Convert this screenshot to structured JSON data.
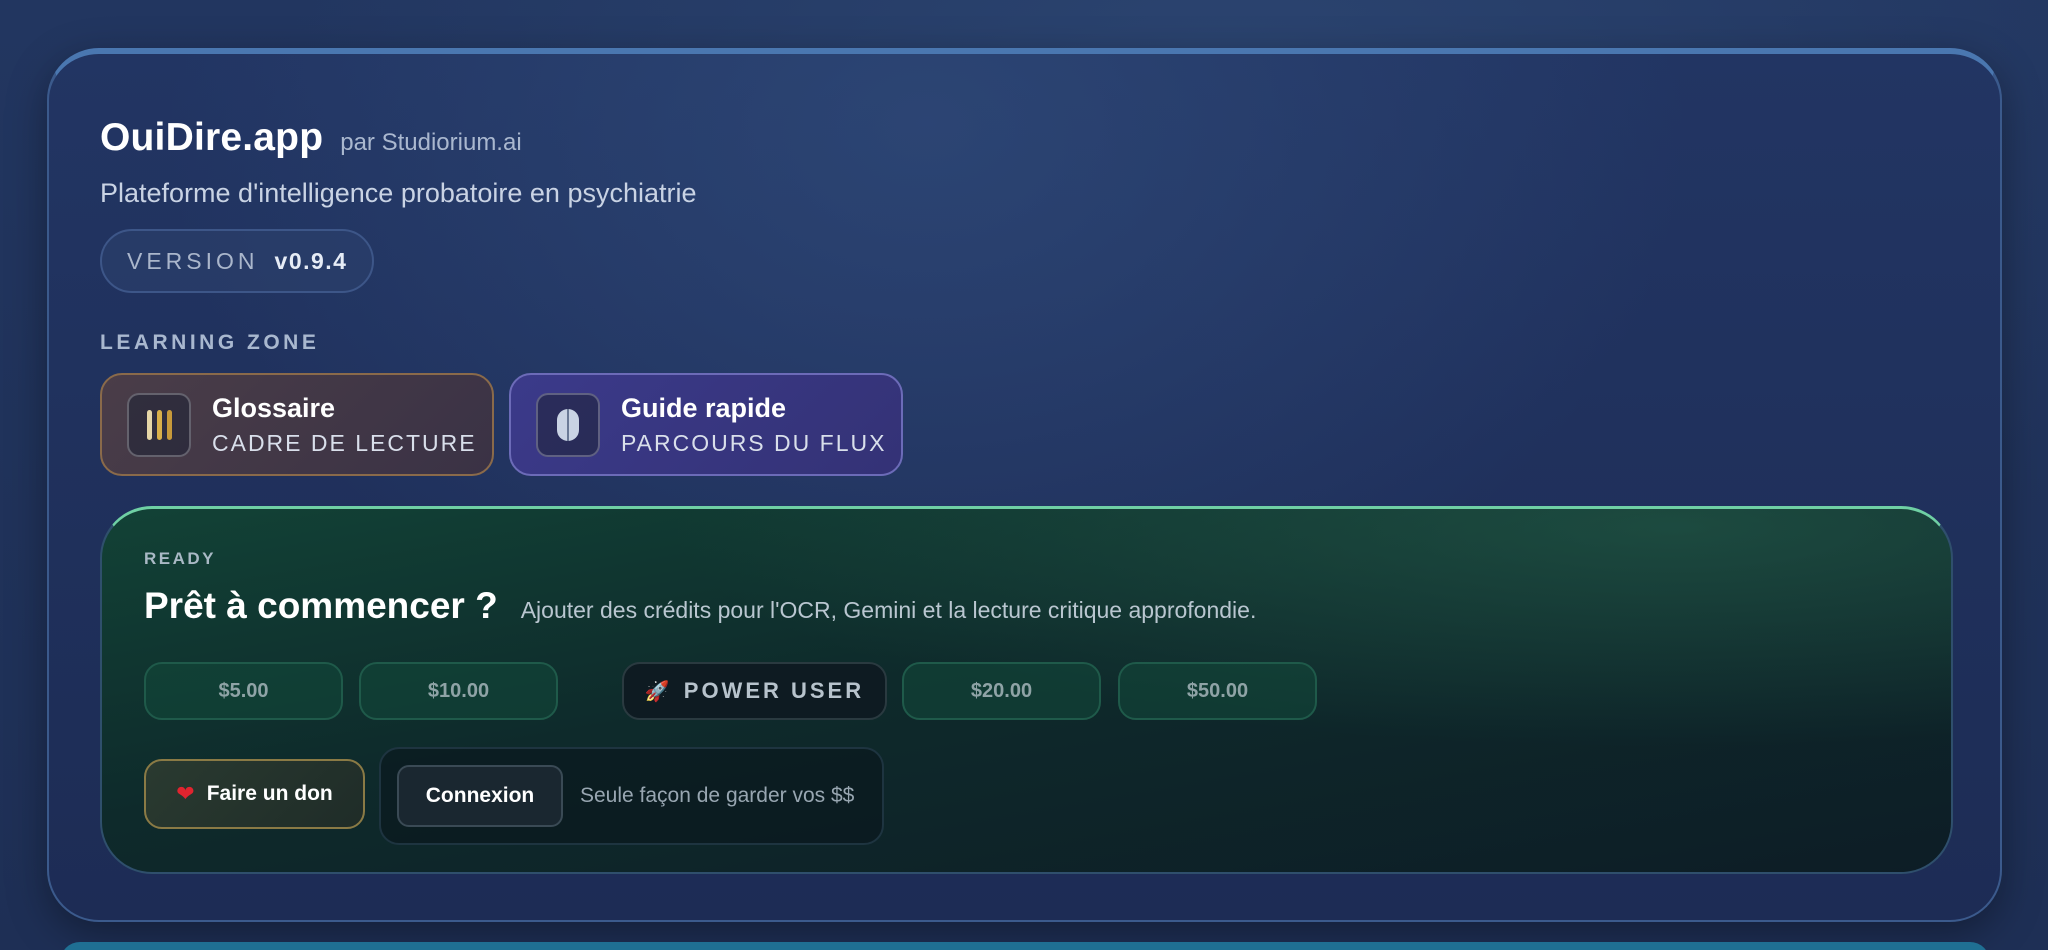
{
  "header": {
    "app_title": "OuiDire.app",
    "app_by": "par Studiorium.ai",
    "subtitle": "Plateforme d'intelligence probatoire en psychiatrie",
    "version_label": "VERSION",
    "version_value": "v0.9.4"
  },
  "learning_zone": {
    "label": "LEARNING ZONE",
    "cards": [
      {
        "title": "Glossaire",
        "subtitle": "CADRE DE LECTURE",
        "icon": "bookshelf-icon"
      },
      {
        "title": "Guide rapide",
        "subtitle": "PARCOURS DU FLUX",
        "icon": "capsule-icon"
      }
    ]
  },
  "ready": {
    "tag": "READY",
    "title": "Prêt à commencer ?",
    "description": "Ajouter des crédits pour l'OCR, Gemini et la lecture critique approfondie.",
    "amounts": [
      "$5.00",
      "$10.00",
      "$20.00",
      "$50.00"
    ],
    "power_user": {
      "label": "POWER USER",
      "icon": "rocket-icon"
    },
    "donate": {
      "label": "Faire un don",
      "icon": "heart-icon"
    },
    "login": {
      "label": "Connexion",
      "hint": "Seule façon de garder vos $$"
    }
  },
  "colors": {
    "background": "#1f3056",
    "ready_accent": "#6fd0a4",
    "glossary_border": "#8a6a4a",
    "guide_border": "#6c6bb8",
    "heart": "#e0242f"
  }
}
